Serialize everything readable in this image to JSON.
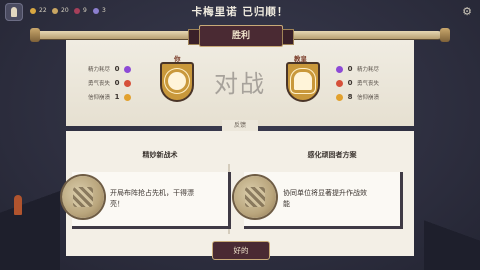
{
  "header": {
    "title": "卡梅里诺 已归顺！",
    "resources": [
      {
        "icon": "gold-coin-icon",
        "value": "22",
        "color": "#d8a742"
      },
      {
        "icon": "food-icon",
        "value": "20",
        "color": "#c9a663"
      },
      {
        "icon": "influence-icon",
        "value": "9",
        "color": "#a63f5a"
      },
      {
        "icon": "faith-icon",
        "value": "3",
        "color": "#8c7fcf"
      }
    ]
  },
  "result": {
    "banner": "胜利"
  },
  "battle": {
    "left": {
      "name": "你",
      "stats": [
        {
          "label": "精力耗尽",
          "value": "0",
          "icon": "lightning-icon",
          "color": "#8d4ad6"
        },
        {
          "label": "勇气丧失",
          "value": "0",
          "icon": "flame-icon",
          "color": "#d6503a"
        },
        {
          "label": "信仰崩溃",
          "value": "1",
          "icon": "sun-icon",
          "color": "#e2a12e"
        }
      ]
    },
    "versus": "对战",
    "right": {
      "name": "教皇",
      "stats": [
        {
          "label": "精力耗尽",
          "value": "0",
          "icon": "lightning-icon",
          "color": "#8d4ad6"
        },
        {
          "label": "勇气丧失",
          "value": "0",
          "icon": "flame-icon",
          "color": "#d6503a"
        },
        {
          "label": "信仰崩溃",
          "value": "8",
          "icon": "sun-icon",
          "color": "#e2a12e"
        }
      ]
    }
  },
  "feedback": {
    "label": "反馈",
    "cards": [
      {
        "title": "精妙新战术",
        "text_line1": "开局布阵抢占先机，干得漂",
        "text_line2": "亮！"
      },
      {
        "title": "感化顽固者方案",
        "text_line1": "协同单位将显著提升作战效",
        "text_line2": "能"
      }
    ]
  },
  "actions": {
    "ok": "好的"
  }
}
